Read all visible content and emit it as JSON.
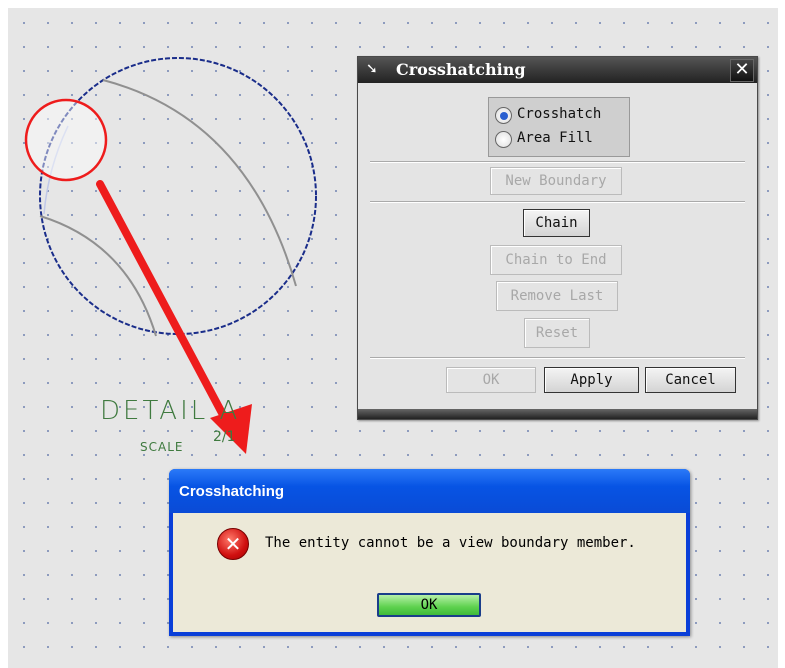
{
  "drawing": {
    "detail_label": "DETAIL A",
    "scale_label": "SCALE",
    "scale_value": "2/1"
  },
  "crosshatch_dialog": {
    "title": "Crosshatching",
    "title_icon": "arrow-cursor-icon",
    "close_icon": "close-icon",
    "options": [
      {
        "label": "Crosshatch",
        "selected": true
      },
      {
        "label": "Area Fill",
        "selected": false
      }
    ],
    "buttons": {
      "new_boundary": "New Boundary",
      "chain": "Chain",
      "chain_to_end": "Chain to End",
      "remove_last": "Remove Last",
      "reset": "Reset",
      "ok": "OK",
      "apply": "Apply",
      "cancel": "Cancel"
    }
  },
  "message_box": {
    "title": "Crosshatching",
    "icon": "error-icon",
    "message": "The entity cannot be a view boundary member.",
    "ok": "OK"
  },
  "colors": {
    "annotation_red": "#ee1c1c",
    "detail_green": "#3f7a3f",
    "boundary_blue": "#1a2d8a",
    "xp_blue": "#0a4bd6"
  }
}
